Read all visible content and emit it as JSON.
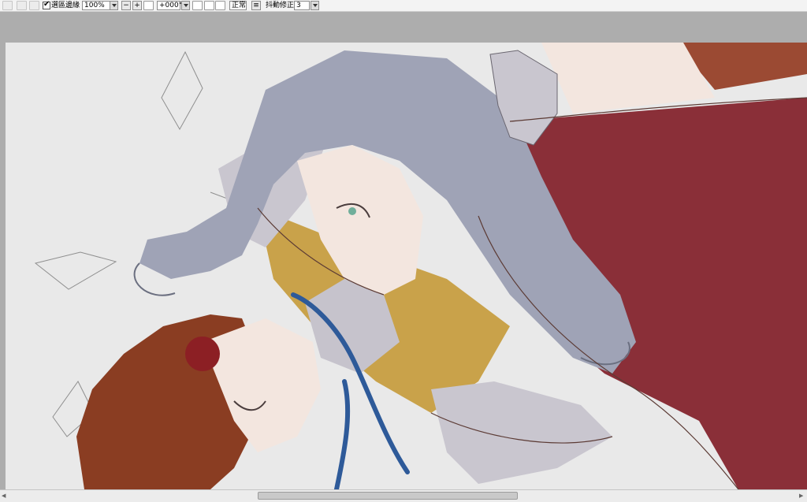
{
  "toolbar": {
    "selection_edge_label": "選區邊緣",
    "selection_edge_checked": "✔",
    "zoom_value": "100%",
    "zoom_out_glyph": "−",
    "zoom_in_glyph": "+",
    "rotation_value": "+000°",
    "blend_mode": "正常",
    "stabilizer_label": "抖動修正",
    "stabilizer_value": "3"
  },
  "canvas": {
    "background_color": "#e9e9e9",
    "palette": {
      "hair_silver": "#9fa3b6",
      "hair_brown": "#8a3d22",
      "coat_red": "#8a2f38",
      "vest_mustard": "#c9a24a",
      "shirt_gray": "#c9c6cf",
      "ribbon_blue": "#2e5a99",
      "skin": "#f3e6df"
    }
  },
  "scrollbar": {
    "left_arrow": "◀",
    "right_arrow": "▶"
  }
}
